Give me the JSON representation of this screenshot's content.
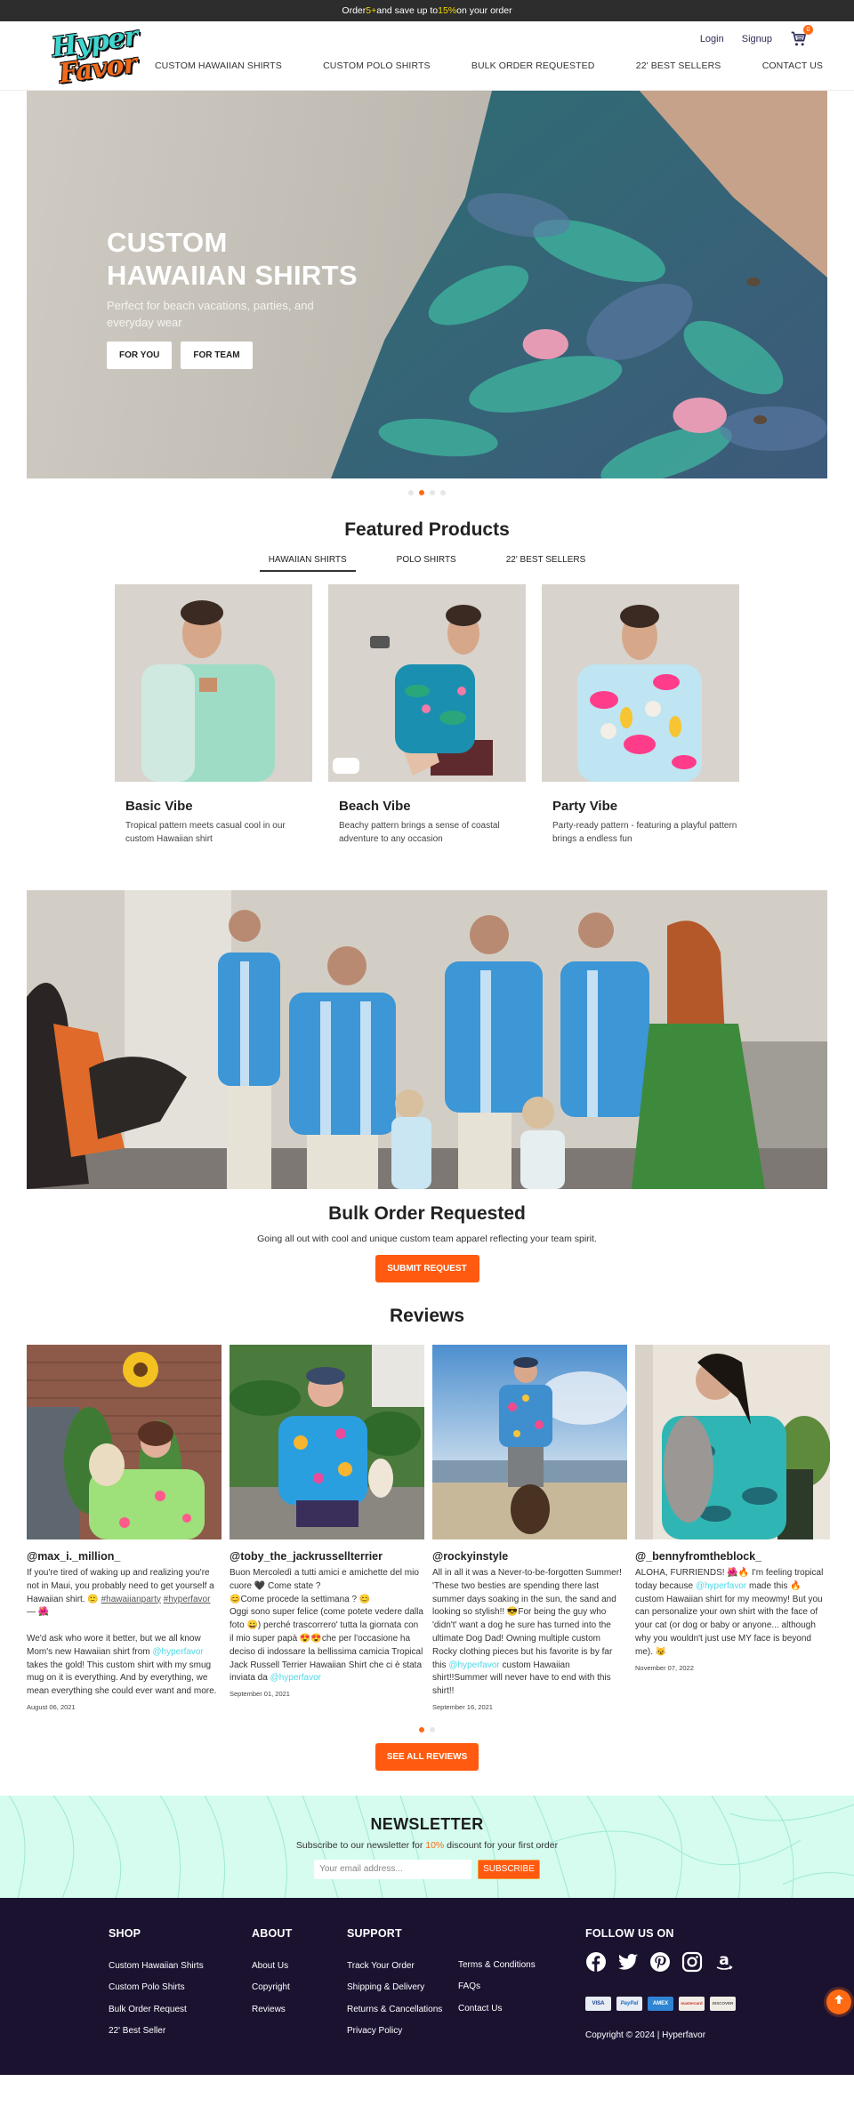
{
  "promo": {
    "prefix": "Order ",
    "qty": "5+",
    "middle": " and save up to ",
    "pct": "15%",
    "suffix": " on your order"
  },
  "header": {
    "logo_line1": "Hyper",
    "logo_line2": "Favor",
    "login": "Login",
    "signup": "Signup",
    "cart_count": "0",
    "nav": [
      "CUSTOM HAWAIIAN SHIRTS",
      "CUSTOM POLO SHIRTS",
      "BULK ORDER REQUESTED",
      "22' BEST SELLERS",
      "CONTACT US"
    ]
  },
  "hero": {
    "title_line1": "CUSTOM",
    "title_line2": "HAWAIIAN SHIRTS",
    "subtitle": "Perfect for beach vacations, parties, and everyday wear",
    "btn_for_you": "FOR YOU",
    "btn_for_team": "FOR TEAM",
    "slides": 4,
    "active_slide": 2
  },
  "featured": {
    "title": "Featured Products",
    "tabs": [
      "HAWAIIAN SHIRTS",
      "POLO SHIRTS",
      "22' BEST SELLERS"
    ],
    "active_tab": 0,
    "products": [
      {
        "name": "Basic Vibe",
        "desc": "Tropical pattern meets casual cool in our custom Hawaiian shirt"
      },
      {
        "name": "Beach Vibe",
        "desc": "Beachy pattern brings a sense of coastal adventure to any occasion"
      },
      {
        "name": "Party Vibe",
        "desc": "Party-ready pattern - featuring a playful pattern brings a endless fun"
      }
    ]
  },
  "bulk": {
    "title": "Bulk Order Requested",
    "subtitle": "Going all out with cool and unique custom team apparel reflecting your team spirit.",
    "button": "SUBMIT REQUEST"
  },
  "reviews": {
    "title": "Reviews",
    "items": [
      {
        "user": "@max_i._million_",
        "text_a": "If you're tired of waking up and realizing you're not in Maui, you probably need to get yourself a Hawaiian shirt. 🙂 ",
        "tag1": "#hawaiianparty",
        "tag2": "#hyperfavor",
        "text_b": " — 🌺\n\nWe'd ask who wore it better, but we all know Mom's new Hawaiian shirt from ",
        "mention": "@hyperfavor",
        "text_c": " takes the gold! This custom shirt with my smug mug on it is everything. And by everything, we mean everything she could ever want and more.",
        "date": "August 06, 2021"
      },
      {
        "user": "@toby_the_jackrussellterrier",
        "text_a": "Buon Mercoledì a tutti amici e amichette del mio cuore 🖤 Come state ?\n😊Come procede la settimana ? 😊\nOggi sono super felice (come potete vedere dalla foto 😀) perché trascorrero' tutta la giornata con il mio super papà 😍😍che per l'occasione ha deciso di indossare la bellissima camicia Tropical Jack Russell Terrier Hawaiian Shirt che ci è stata inviata da ",
        "mention": "@hyperfavor",
        "text_c": "",
        "date": "September 01, 2021"
      },
      {
        "user": "@rockyinstyle",
        "text_a": "All in all it was a Never-to-be-forgotten Summer! 'These two besties are spending there last summer days soaking in the sun, the sand and looking so stylish!! 😎For being the guy who 'didn't' want a dog he sure has turned into the ultimate Dog Dad! Owning multiple custom Rocky clothing pieces but his favorite is by far this ",
        "mention": "@hyperfavor",
        "text_c": " custom Hawaiian shirt!!Summer will never have to end with this shirt!!",
        "date": "September 16, 2021"
      },
      {
        "user": "@_bennyfromtheblock_",
        "text_a": "ALOHA, FURRIENDS! 🌺🔥 I'm feeling tropical today because ",
        "mention": "@hyperfavor",
        "text_c": " made this 🔥 custom Hawaiian shirt for my meowmy! But you can personalize your own shirt with the face of your cat (or dog or baby or anyone... although why you wouldn't just use MY face is beyond me). 😼",
        "date": "November 07, 2022"
      }
    ],
    "pages": 2,
    "active_page": 1,
    "button": "SEE ALL REVIEWS"
  },
  "newsletter": {
    "title": "NEWSLETTER",
    "sub_prefix": "Subscribe to our newsletter for ",
    "sub_pct": "10%",
    "sub_suffix": " discount for your first order",
    "placeholder": "Your email address...",
    "button": "SUBSCRIBE"
  },
  "footer": {
    "shop": {
      "title": "SHOP",
      "links": [
        "Custom Hawaiian Shirts",
        "Custom Polo Shirts",
        "Bulk Order Request",
        "22' Best Seller"
      ]
    },
    "about": {
      "title": "ABOUT",
      "links": [
        "About Us",
        "Copyright",
        "Reviews"
      ]
    },
    "support": {
      "title": "SUPPORT",
      "links_a": [
        "Track Your Order",
        "Shipping & Delivery",
        "Returns & Cancellations",
        "Privacy Policy"
      ],
      "links_b": [
        "Terms & Conditions",
        "FAQs",
        "Contact Us"
      ]
    },
    "follow": {
      "title": "FOLLOW US ON",
      "networks": [
        "facebook",
        "twitter",
        "pinterest",
        "instagram",
        "amazon"
      ]
    },
    "payments": [
      "VISA",
      "PayPal",
      "AMEX",
      "mastercard",
      "DISCOVER"
    ],
    "copyright": "Copyright © 2024 | Hyperfavor"
  },
  "colors": {
    "accent": "#ff5a0f",
    "mention": "#4dd9e6",
    "footer_bg": "#1b1230",
    "newsletter_bg": "#d5fcef",
    "promo_highlight": "#f5d800"
  }
}
